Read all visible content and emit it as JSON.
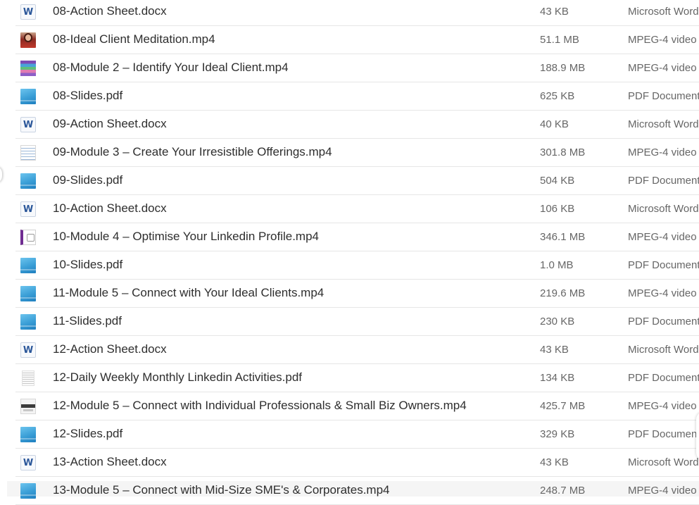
{
  "files": [
    {
      "name": "08-Action Sheet.docx",
      "size": "43 KB",
      "kind": "Microsoft Word",
      "icon": "word-doc-icon"
    },
    {
      "name": "08-Ideal Client Meditation.mp4",
      "size": "51.1 MB",
      "kind": "MPEG-4 video",
      "icon": "video-thumbnail-person-icon"
    },
    {
      "name": "08-Module 2 – Identify Your Ideal Client.mp4",
      "size": "188.9 MB",
      "kind": "MPEG-4 video",
      "icon": "video-thumbnail-colorful-icon"
    },
    {
      "name": "08-Slides.pdf",
      "size": "625 KB",
      "kind": "PDF Document",
      "icon": "pdf-icon"
    },
    {
      "name": "09-Action Sheet.docx",
      "size": "40 KB",
      "kind": "Microsoft Word",
      "icon": "word-doc-icon"
    },
    {
      "name": "09-Module 3 – Create Your Irresistible Offerings.mp4",
      "size": "301.8 MB",
      "kind": "MPEG-4 video",
      "icon": "video-thumbnail-document-icon"
    },
    {
      "name": "09-Slides.pdf",
      "size": "504 KB",
      "kind": "PDF Document",
      "icon": "pdf-icon"
    },
    {
      "name": "10-Action Sheet.docx",
      "size": "106 KB",
      "kind": "Microsoft Word",
      "icon": "word-doc-icon"
    },
    {
      "name": "10-Module 4 – Optimise Your Linkedin Profile.mp4",
      "size": "346.1 MB",
      "kind": "MPEG-4 video",
      "icon": "video-thumbnail-slide-icon"
    },
    {
      "name": "10-Slides.pdf",
      "size": "1.0 MB",
      "kind": "PDF Document",
      "icon": "pdf-icon"
    },
    {
      "name": "11-Module 5 – Connect with Your Ideal Clients.mp4",
      "size": "219.6 MB",
      "kind": "MPEG-4 video",
      "icon": "video-thumbnail-blue-icon"
    },
    {
      "name": "11-Slides.pdf",
      "size": "230 KB",
      "kind": "PDF Document",
      "icon": "pdf-icon"
    },
    {
      "name": "12-Action Sheet.docx",
      "size": "43 KB",
      "kind": "Microsoft Word",
      "icon": "word-doc-icon"
    },
    {
      "name": "12-Daily Weekly Monthly Linkedin Activities.pdf",
      "size": "134 KB",
      "kind": "PDF Document",
      "icon": "pdf-page-icon"
    },
    {
      "name": "12-Module 5 – Connect with Individual Professionals & Small Biz Owners.mp4",
      "size": "425.7 MB",
      "kind": "MPEG-4 video",
      "icon": "video-thumbnail-screen-icon"
    },
    {
      "name": "12-Slides.pdf",
      "size": "329 KB",
      "kind": "PDF Document",
      "icon": "pdf-icon"
    },
    {
      "name": "13-Action Sheet.docx",
      "size": "43 KB",
      "kind": "Microsoft Word",
      "icon": "word-doc-icon"
    },
    {
      "name": "13-Module 5 – Connect with Mid-Size SME's & Corporates.mp4",
      "size": "248.7 MB",
      "kind": "MPEG-4 video",
      "icon": "video-thumbnail-blue-icon"
    }
  ],
  "word_icon_glyph": "W",
  "colors": {
    "word_blue": "#2b579a",
    "pdf_blue": "#3a9ed6",
    "text": "#2e2e2e",
    "muted": "#666666"
  }
}
